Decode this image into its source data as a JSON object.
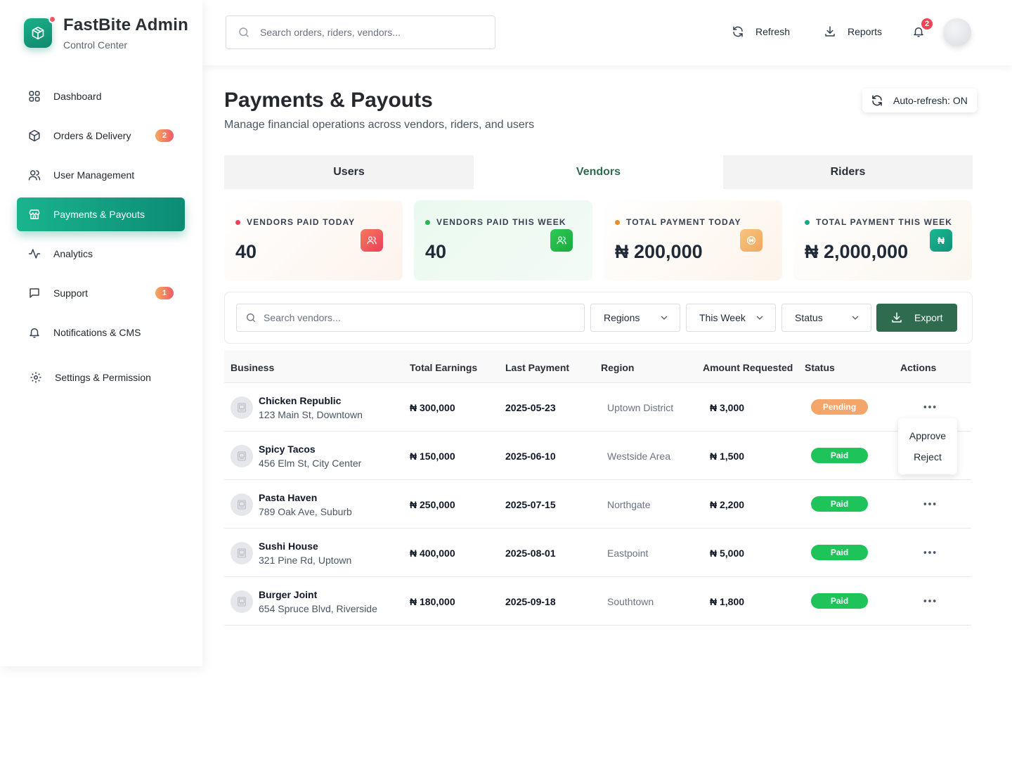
{
  "brand": {
    "title": "FastBite Admin",
    "subtitle": "Control Center"
  },
  "sidebar": {
    "items": [
      {
        "label": "Dashboard",
        "icon": "grid-icon"
      },
      {
        "label": "Orders & Delivery",
        "icon": "box-icon",
        "badge": "2"
      },
      {
        "label": "User Management",
        "icon": "users-icon"
      },
      {
        "label": "Payments & Payouts",
        "icon": "store-icon",
        "active": true
      },
      {
        "label": "Analytics",
        "icon": "activity-icon"
      },
      {
        "label": "Support",
        "icon": "message-icon",
        "badge": "1"
      },
      {
        "label": "Notifications & CMS",
        "icon": "bell-icon"
      },
      {
        "label": "Settings & Permission",
        "icon": "gear-icon"
      }
    ]
  },
  "topbar": {
    "search_placeholder": "Search orders, riders, vendors...",
    "refresh_label": "Refresh",
    "reports_label": "Reports",
    "notification_count": "2"
  },
  "page": {
    "title": "Payments & Payouts",
    "subtitle": "Manage financial operations across vendors, riders, and users",
    "auto_refresh": "Auto-refresh: ON"
  },
  "tabs": [
    {
      "label": "Users"
    },
    {
      "label": "Vendors",
      "active": true
    },
    {
      "label": "Riders"
    }
  ],
  "stats": [
    {
      "label": "VENDORS PAID TODAY",
      "value": "40",
      "dot": "#ef4458",
      "icon_bg": "#ef4458",
      "icon": "users-icon"
    },
    {
      "label": "VENDORS PAID THIS WEEK",
      "value": "40",
      "dot": "#22b84a",
      "icon_bg": "#22b84a",
      "icon": "users-icon"
    },
    {
      "label": "TOTAL PAYMENT TODAY",
      "value": "₦ 200,000",
      "dot": "#f08a1c",
      "icon_bg": "#f3b66e",
      "icon": "coin-icon"
    },
    {
      "label": "TOTAL PAYMENT THIS WEEK",
      "value": "₦ 2,000,000",
      "dot": "#19a98a",
      "icon_bg": "#129e7f",
      "icon": "naira-icon",
      "icon_text": "₦"
    }
  ],
  "filters": {
    "search_placeholder": "Search vendors...",
    "region_label": "Regions",
    "period_label": "This Week",
    "status_label": "Status",
    "export_label": "Export"
  },
  "table": {
    "headers": [
      "Business",
      "Total Earnings",
      "Last Payment",
      "Region",
      "Amount Requested",
      "Status",
      "Actions"
    ],
    "rows": [
      {
        "business": "Chicken Republic",
        "address": "123 Main St, Downtown",
        "earnings": "₦ 300,000",
        "last_payment": "2025-05-23",
        "region": "Uptown District",
        "requested": "₦ 3,000",
        "status": "Pending"
      },
      {
        "business": "Spicy Tacos",
        "address": "456 Elm St, City Center",
        "earnings": "₦ 150,000",
        "last_payment": "2025-06-10",
        "region": "Westside Area",
        "requested": "₦ 1,500",
        "status": "Paid"
      },
      {
        "business": "Pasta Haven",
        "address": "789 Oak Ave, Suburb",
        "earnings": "₦ 250,000",
        "last_payment": "2025-07-15",
        "region": "Northgate",
        "requested": "₦ 2,200",
        "status": "Paid"
      },
      {
        "business": "Sushi House",
        "address": "321 Pine Rd, Uptown",
        "earnings": "₦ 400,000",
        "last_payment": "2025-08-01",
        "region": "Eastpoint",
        "requested": "₦ 5,000",
        "status": "Paid"
      },
      {
        "business": "Burger Joint",
        "address": "654 Spruce Blvd, Riverside",
        "earnings": "₦ 180,000",
        "last_payment": "2025-09-18",
        "region": "Southtown",
        "requested": "₦ 1,800",
        "status": "Paid"
      }
    ]
  },
  "action_menu": {
    "approve_label": "Approve",
    "reject_label": "Reject"
  },
  "colors": {
    "accent": "#2e6b4f",
    "brand_green": "#12a07f",
    "pending": "#f3a56a",
    "paid": "#1ec45a"
  }
}
